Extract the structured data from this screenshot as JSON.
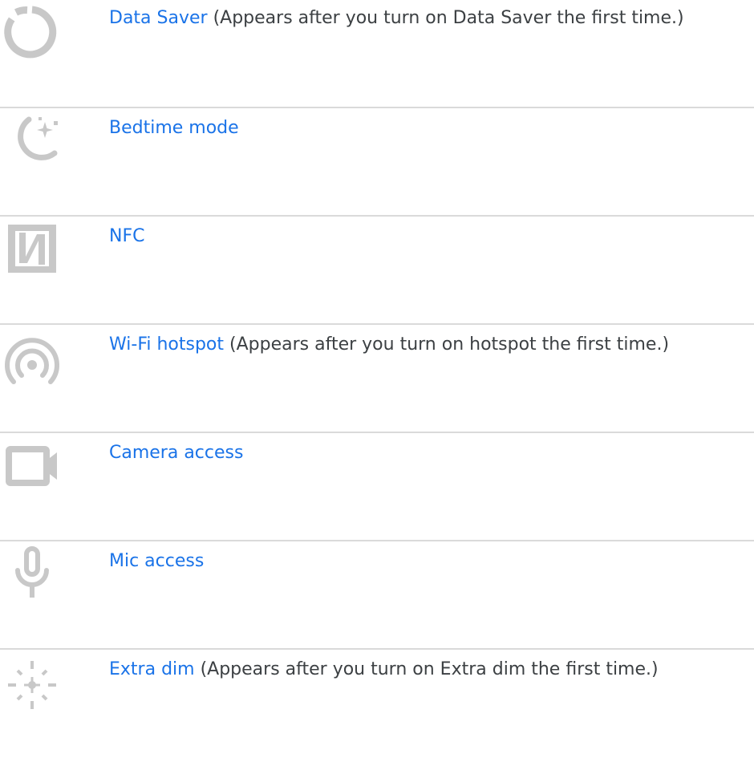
{
  "rows": [
    {
      "icon": "data-saver-icon",
      "link": "Data Saver",
      "note": "(Appears after you turn on Data Saver the first time.)"
    },
    {
      "icon": "bedtime-icon",
      "link": "Bedtime mode",
      "note": ""
    },
    {
      "icon": "nfc-icon",
      "link": "NFC",
      "note": ""
    },
    {
      "icon": "wifi-hotspot-icon",
      "link": "Wi-Fi hotspot",
      "note": "(Appears after you turn on hotspot the first time.)"
    },
    {
      "icon": "camera-icon",
      "link": "Camera access",
      "note": ""
    },
    {
      "icon": "mic-icon",
      "link": "Mic access",
      "note": ""
    },
    {
      "icon": "extra-dim-icon",
      "link": "Extra dim",
      "note": "(Appears after you turn on Extra dim the first time.)"
    }
  ],
  "colors": {
    "link": "#1a73e8",
    "text": "#3c4043",
    "icon": "#c8c8c8",
    "divider": "#dadada"
  }
}
